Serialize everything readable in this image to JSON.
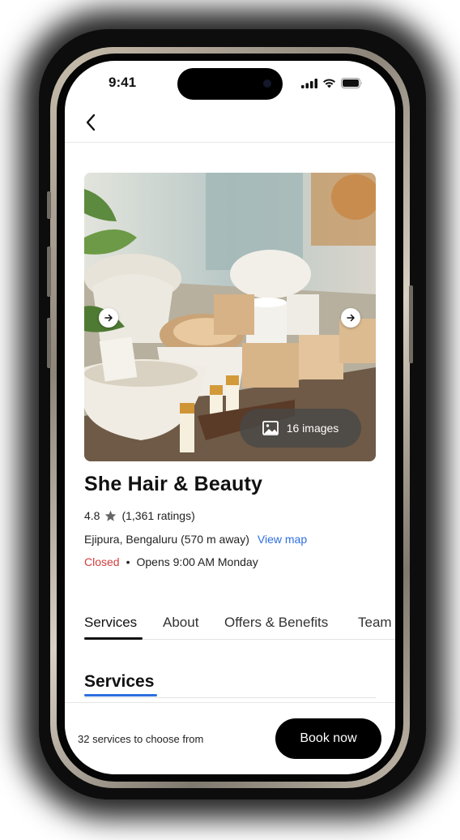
{
  "status_bar": {
    "time": "9:41"
  },
  "gallery": {
    "image_count_label": "16 images"
  },
  "salon": {
    "name": "She Hair & Beauty",
    "rating": "4.8",
    "ratings_count": "(1,361 ratings)",
    "location": "Ejipura, Bengaluru (570 m away)",
    "map_link": "View map",
    "status": "Closed",
    "separator": "•",
    "opens": "Opens 9:00 AM Monday"
  },
  "tabs": [
    {
      "label": "Services",
      "active": true
    },
    {
      "label": "About",
      "active": false
    },
    {
      "label": "Offers & Benefits",
      "active": false
    },
    {
      "label": "Team",
      "active": false
    }
  ],
  "section": {
    "heading": "Services"
  },
  "footer": {
    "services_count": "32 services to choose from",
    "book_label": "Book now"
  },
  "colors": {
    "accent_blue": "#2e6fe0",
    "closed_red": "#d23c3c",
    "button_black": "#000000"
  },
  "icons": [
    "back-chevron-icon",
    "signal-icon",
    "wifi-icon",
    "battery-icon",
    "arrow-right-icon",
    "image-icon",
    "star-icon"
  ]
}
